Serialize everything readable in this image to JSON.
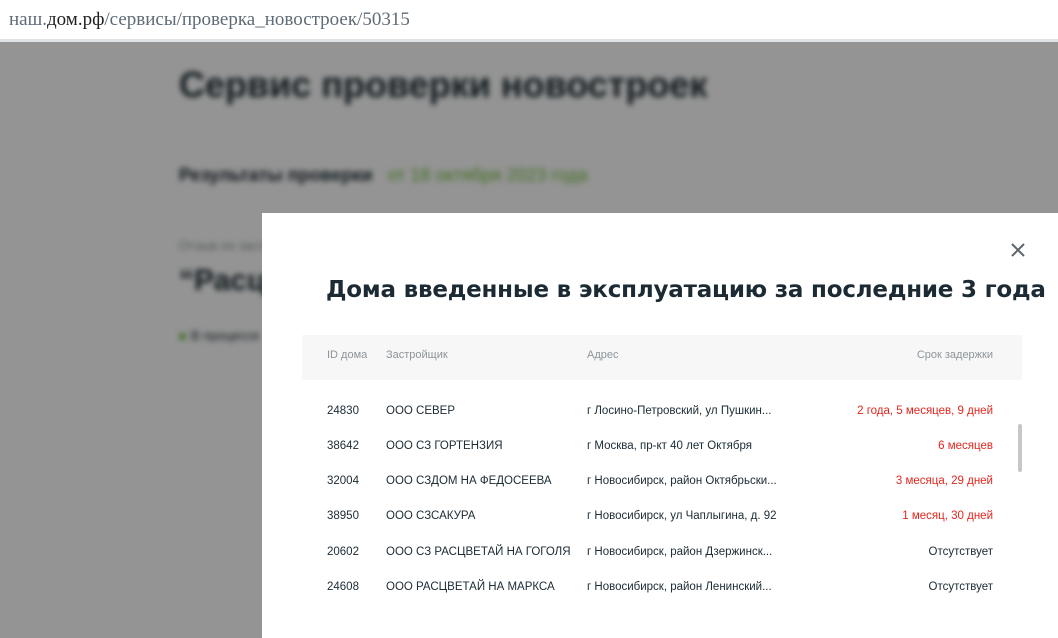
{
  "browser": {
    "url_prefix": "наш.",
    "url_host": "дом.рф",
    "url_path": "/сервисы/проверка_новостроек/50315"
  },
  "background_page": {
    "title": "Сервис проверки новостроек",
    "results_label": "Результаты проверки",
    "results_date": "от 18 октября 2023 года",
    "object_label": "Отзыв по застройщику",
    "quote_title": "“Расц",
    "status_text": "В процессе"
  },
  "modal": {
    "title": "Дома введенные в эксплуатацию за последние 3 года",
    "columns": {
      "id": "ID дома",
      "developer": "Застройщик",
      "address": "Адрес",
      "delay": "Срок задержки"
    },
    "rows": [
      {
        "id": "24830",
        "developer": "ООО СЕВЕР",
        "address": "г Лосино-Петровский, ул Пушкин...",
        "delay": "2 года, 5 месяцев, 9 дней"
      },
      {
        "id": "38642",
        "developer": "ООО СЗ ГОРТЕНЗИЯ",
        "address": "г Москва, пр-кт 40 лет Октября",
        "delay": "6 месяцев"
      },
      {
        "id": "32004",
        "developer": "ООО СЗДОМ НА ФЕДОСЕЕВА",
        "address": "г Новосибирск, район Октябрьски...",
        "delay": "3 месяца, 29 дней"
      },
      {
        "id": "38950",
        "developer": "ООО СЗСАКУРА",
        "address": "г Новосибирск, ул Чаплыгина, д. 92",
        "delay": "1 месяц, 30 дней"
      },
      {
        "id": "20602",
        "developer": "ООО СЗ РАСЦВЕТАЙ НА ГОГОЛЯ",
        "address": "г Новосибирск, район Дзержинск...",
        "delay": "Отсутствует"
      },
      {
        "id": "24608",
        "developer": "ООО РАСЦВЕТАЙ НА МАРКСА",
        "address": "г Новосибирск, район Ленинский...",
        "delay": "Отсутствует"
      }
    ]
  },
  "colors": {
    "delay_red": "#e3261d",
    "accent_green": "#6fbf3a",
    "text_dark": "#1b2a33"
  },
  "icons": {
    "close": "close-icon"
  }
}
